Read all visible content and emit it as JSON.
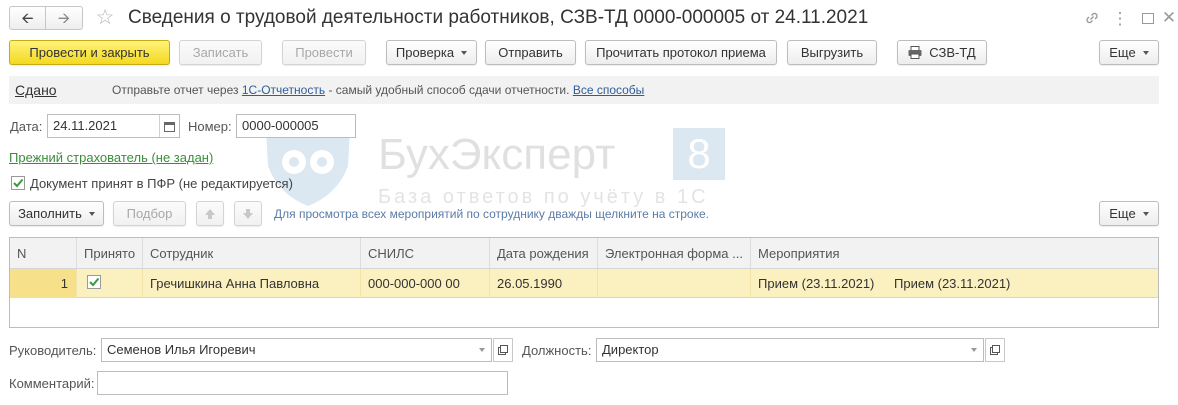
{
  "window": {
    "title": "Сведения о трудовой деятельности работников, СЗВ-ТД 0000-000005 от 24.11.2021"
  },
  "toolbar": {
    "post_close": "Провести и закрыть",
    "save": "Записать",
    "post": "Провести",
    "check": "Проверка",
    "send": "Отправить",
    "read_protocol": "Прочитать протокол приема",
    "export": "Выгрузить",
    "print_szv": "СЗВ-ТД",
    "more": "Еще"
  },
  "status_bar": {
    "status": "Сдано",
    "text_before": "Отправьте отчет через",
    "link_service": "1С-Отчетность",
    "text_after": "- самый удобный способ сдачи отчетности.",
    "link_all": "Все способы"
  },
  "form": {
    "date_label": "Дата:",
    "date_value": "24.11.2021",
    "number_label": "Номер:",
    "number_value": "0000-000005",
    "prev_insurer_link": "Прежний страхователь (не задан)",
    "accepted_checkbox_label": "Документ принят в ПФР (не редактируется)",
    "accepted_checked": true
  },
  "table_toolbar": {
    "fill": "Заполнить",
    "select": "Подбор",
    "hint": "Для просмотра всех мероприятий по сотруднику дважды щелкните на строке.",
    "more": "Еще"
  },
  "table": {
    "columns": [
      "N",
      "Принято",
      "Сотрудник",
      "СНИЛС",
      "Дата рождения",
      "Электронная форма ...",
      "Мероприятия"
    ],
    "rows": [
      {
        "n": "1",
        "accepted": true,
        "employee": "Гречишкина Анна Павловна",
        "snils": "000-000-000 00",
        "birth_date": "26.05.1990",
        "e_form": "",
        "event_1": "Прием (23.11.2021)",
        "event_2": "Прием (23.11.2021)"
      }
    ]
  },
  "footer": {
    "manager_label": "Руководитель:",
    "manager_value": "Семенов Илья Игоревич",
    "position_label": "Должность:",
    "position_value": "Директор",
    "comment_label": "Комментарий:",
    "comment_value": ""
  },
  "watermark": {
    "title": "БухЭксперт",
    "badge": "8",
    "subtitle": "База ответов по учёту в 1С"
  },
  "colors": {
    "primary_button": "#f4d91f",
    "selected_row": "#fbf0c0",
    "link": "#2d5d9b",
    "green_link": "#3b8d3b"
  }
}
